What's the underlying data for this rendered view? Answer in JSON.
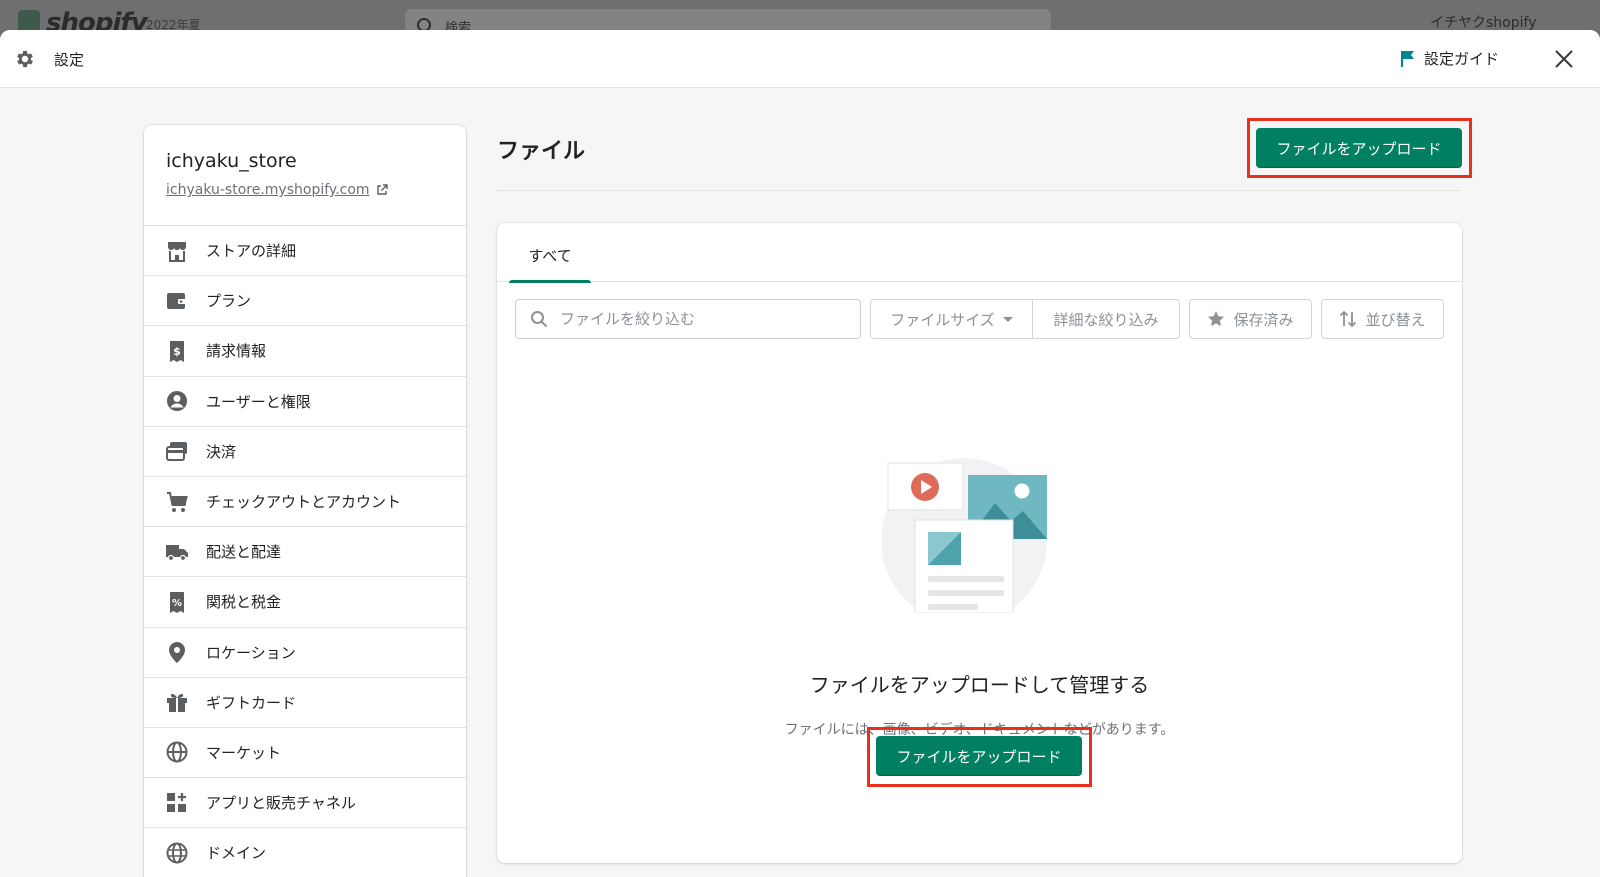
{
  "backdrop": {
    "brand": "shopify",
    "subtitle": "2022年夏",
    "search_placeholder": "検索",
    "user": "イチヤクshopify"
  },
  "header": {
    "title": "設定",
    "guide_label": "設定ガイド"
  },
  "store": {
    "name": "ichyaku_store",
    "url": "ichyaku-store.myshopify.com"
  },
  "sidebar": {
    "items": [
      {
        "label": "ストアの詳細",
        "icon": "store-icon"
      },
      {
        "label": "プラン",
        "icon": "wallet-icon"
      },
      {
        "label": "請求情報",
        "icon": "billing-icon"
      },
      {
        "label": "ユーザーと権限",
        "icon": "user-icon"
      },
      {
        "label": "決済",
        "icon": "payment-icon"
      },
      {
        "label": "チェックアウトとアカウント",
        "icon": "cart-icon"
      },
      {
        "label": "配送と配達",
        "icon": "truck-icon"
      },
      {
        "label": "関税と税金",
        "icon": "tax-icon"
      },
      {
        "label": "ロケーション",
        "icon": "location-icon"
      },
      {
        "label": "ギフトカード",
        "icon": "gift-icon"
      },
      {
        "label": "マーケット",
        "icon": "globe-icon"
      },
      {
        "label": "アプリと販売チャネル",
        "icon": "apps-icon"
      },
      {
        "label": "ドメイン",
        "icon": "domain-icon"
      }
    ]
  },
  "main": {
    "title": "ファイル",
    "upload_label": "ファイルをアップロード",
    "tabs": [
      {
        "label": "すべて"
      }
    ],
    "filter_placeholder": "ファイルを絞り込む",
    "filesize_label": "ファイルサイズ",
    "more_filters_label": "詳細な絞り込み",
    "saved_label": "保存済み",
    "sort_label": "並び替え",
    "empty_title": "ファイルをアップロードして管理する",
    "empty_subtitle": "ファイルには、画像、ビデオ、ドキュメントなどがあります。"
  },
  "colors": {
    "primary": "#008060",
    "highlight": "#e8301d",
    "accent_teal": "#47c1bf"
  }
}
